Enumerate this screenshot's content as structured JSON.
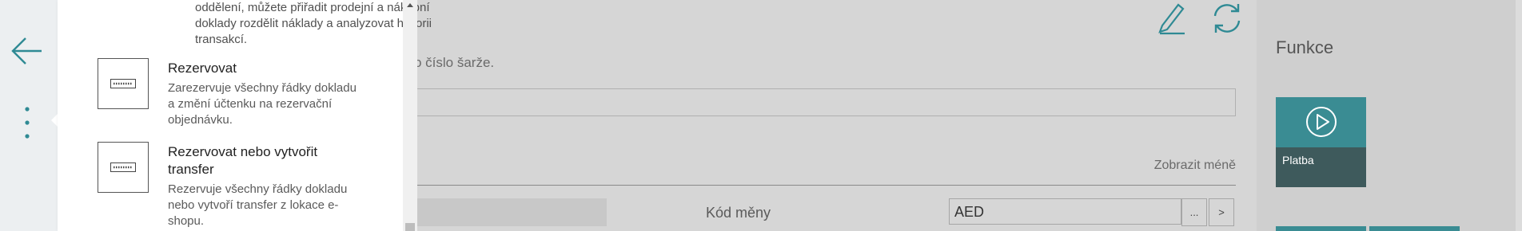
{
  "dropdown": {
    "intro_text": "oddělení, můžete přiřadit prodejní a nákupní doklady rozdělit náklady a analyzovat historii transakcí.",
    "items": [
      {
        "title": "Rezervovat",
        "description": "Zarezervuje všechny řádky dokladu a změní účtenku na rezervační objednávku.",
        "icon": "keyboard-icon"
      },
      {
        "title": "Rezervovat nebo vytvořit transfer",
        "description": "Rezervuje všechny řádky dokladu nebo vytvoří transfer z lokace e-shopu.",
        "icon": "keyboard-icon"
      }
    ]
  },
  "main": {
    "helper_text": "o číslo šarže.",
    "toggle_label": "Zobrazit méně",
    "currency": {
      "label": "Kód měny",
      "value": "AED",
      "lookup_label": "...",
      "next_label": ">"
    }
  },
  "factbox": {
    "title": "Funkce",
    "tile": {
      "label": "Platba",
      "icon": "play-circle-icon"
    }
  },
  "colors": {
    "accent": "#3a8c93",
    "tile_bottom": "#3e5a5c",
    "icon_teal": "#2f8a94"
  }
}
